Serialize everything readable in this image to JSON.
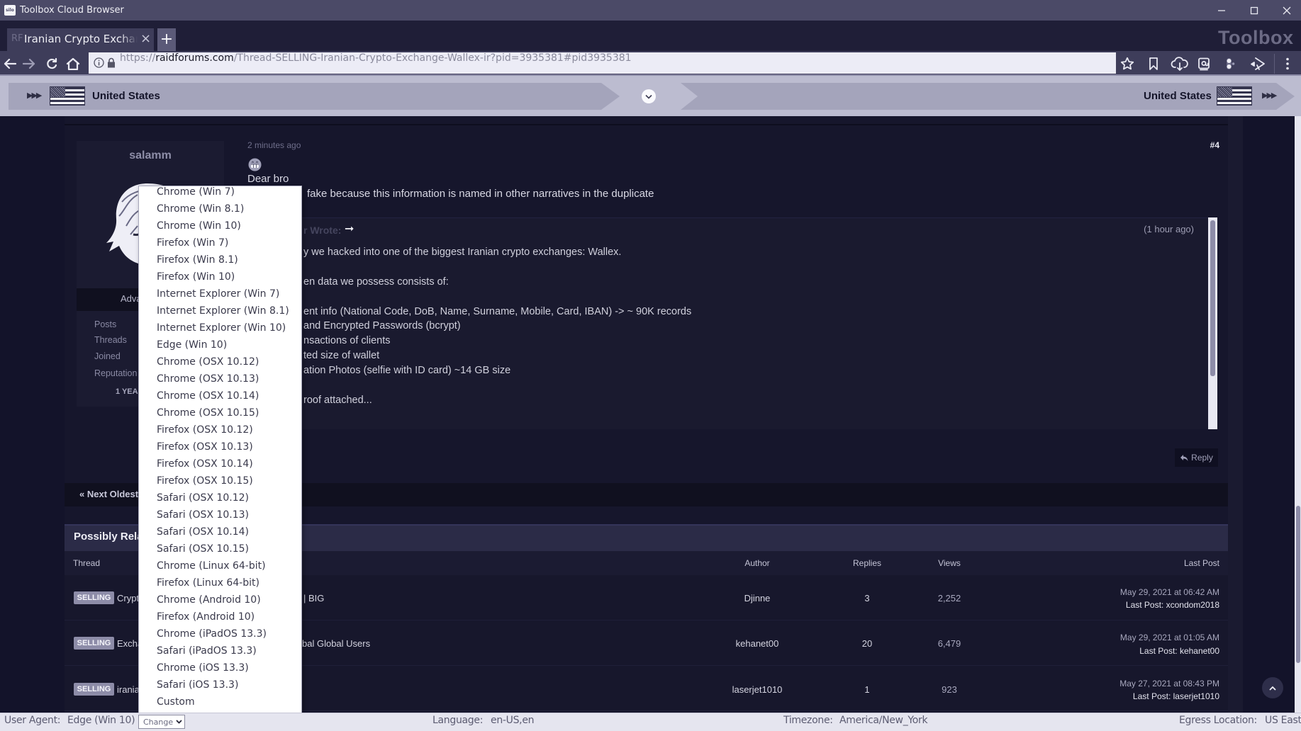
{
  "window": {
    "app_icon_text": "silo",
    "title": "Toolbox Cloud Browser"
  },
  "tabs": [
    {
      "favicon_text": "RF",
      "title": "Iranian Crypto Exchange",
      "close_glyph": "×",
      "active": true
    }
  ],
  "new_tab_glyph": "+",
  "brand": "Toolbox",
  "address_bar": {
    "scheme": "https://",
    "domain": "raidforums.com",
    "path": "/Thread-SELLING-Iranian-Crypto-Exchange-Wallex-ir?pid=3935381#pid3935381"
  },
  "toolbar_icons": [
    "star-icon",
    "bookmark-icon",
    "cloud-download-icon",
    "email-icon",
    "toggle-icon",
    "share-icon",
    "kebab-menu-icon"
  ],
  "location_bar": {
    "left_country": "United States",
    "right_country": "United States",
    "arrows_glyph": "▶▶▶"
  },
  "post": {
    "author": {
      "username": "salamm",
      "rank_visible": "Adva",
      "stats_labels": [
        "Posts",
        "Threads",
        "Joined",
        "Reputation"
      ],
      "tenure_visible": "1 YEA"
    },
    "time": "2 minutes ago",
    "number": "#4",
    "lines": [
      "Dear bro",
      "fake because this information is named in other narratives in the duplicate"
    ],
    "quote": {
      "author_visible": "r Wrote:",
      "arrow_glyph": "➞",
      "time": "(1 hour ago)",
      "lines": [
        "y we hacked into one of the biggest Iranian crypto exchanges: Wallex.",
        "en data we possess consists of:",
        "ent info (National Code, DoB, Name, Surname, Mobile, Card, IBAN) -> ~ 90K records",
        "and Encrypted Passwords (bcrypt)",
        "nsactions of clients",
        "ted size of wallet",
        "ation Photos (selfie with ID card) ~14 GB size",
        "roof attached..."
      ]
    },
    "reply_label": "Reply"
  },
  "thread_nav": {
    "next_oldest": "« Next Oldest |"
  },
  "related": {
    "title_visible": "Possibly Rela",
    "columns": {
      "thread": "Thread",
      "author": "Author",
      "replies": "Replies",
      "views": "Views",
      "last_post": "Last Post"
    },
    "rows": [
      {
        "prefix": "SELLING",
        "title_left": "Crypt",
        "title_right": "| BIG",
        "author": "Djinne",
        "replies": "3",
        "views": "2,252",
        "date": "May 29, 2021 at 06:42 AM",
        "last_post": "Last Post: xcondom2018"
      },
      {
        "prefix": "SELLING",
        "title_left": "Excha",
        "title_right": "bal Global Users",
        "author": "kehanet00",
        "replies": "20",
        "views": "6,479",
        "date": "May 29, 2021 at 01:05 AM",
        "last_post": "Last Post: kehanet00"
      },
      {
        "prefix": "SELLING",
        "title_left": "irania",
        "title_right": "",
        "author": "laserjet1010",
        "replies": "1",
        "views": "923",
        "date": "May 27, 2021 at 08:43 PM",
        "last_post": "Last Post: laserjet1010"
      }
    ]
  },
  "user_agent_menu": {
    "selected": "Edge (Win 10)",
    "options": [
      "Chrome (Win 7)",
      "Chrome (Win 8.1)",
      "Chrome (Win 10)",
      "Firefox (Win 7)",
      "Firefox (Win 8.1)",
      "Firefox (Win 10)",
      "Internet Explorer (Win 7)",
      "Internet Explorer (Win 8.1)",
      "Internet Explorer (Win 10)",
      "Edge (Win 10)",
      "Chrome (OSX 10.12)",
      "Chrome (OSX 10.13)",
      "Chrome (OSX 10.14)",
      "Chrome (OSX 10.15)",
      "Firefox (OSX 10.12)",
      "Firefox (OSX 10.13)",
      "Firefox (OSX 10.14)",
      "Firefox (OSX 10.15)",
      "Safari (OSX 10.12)",
      "Safari (OSX 10.13)",
      "Safari (OSX 10.14)",
      "Safari (OSX 10.15)",
      "Chrome (Linux 64-bit)",
      "Firefox (Linux 64-bit)",
      "Chrome (Android 10)",
      "Firefox (Android 10)",
      "Chrome (iPadOS 13.3)",
      "Safari (iPadOS 13.3)",
      "Chrome (iOS 13.3)",
      "Safari (iOS 13.3)",
      "Custom"
    ]
  },
  "status_bar": {
    "user_agent_label": "User Agent:",
    "user_agent_value": "Edge (Win 10)",
    "change_label": "Change",
    "language_label": "Language:",
    "language_value": "en-US,en",
    "timezone_label": "Timezone:",
    "timezone_value": "America/New_York",
    "egress_label": "Egress Location:",
    "egress_value": "US East"
  }
}
